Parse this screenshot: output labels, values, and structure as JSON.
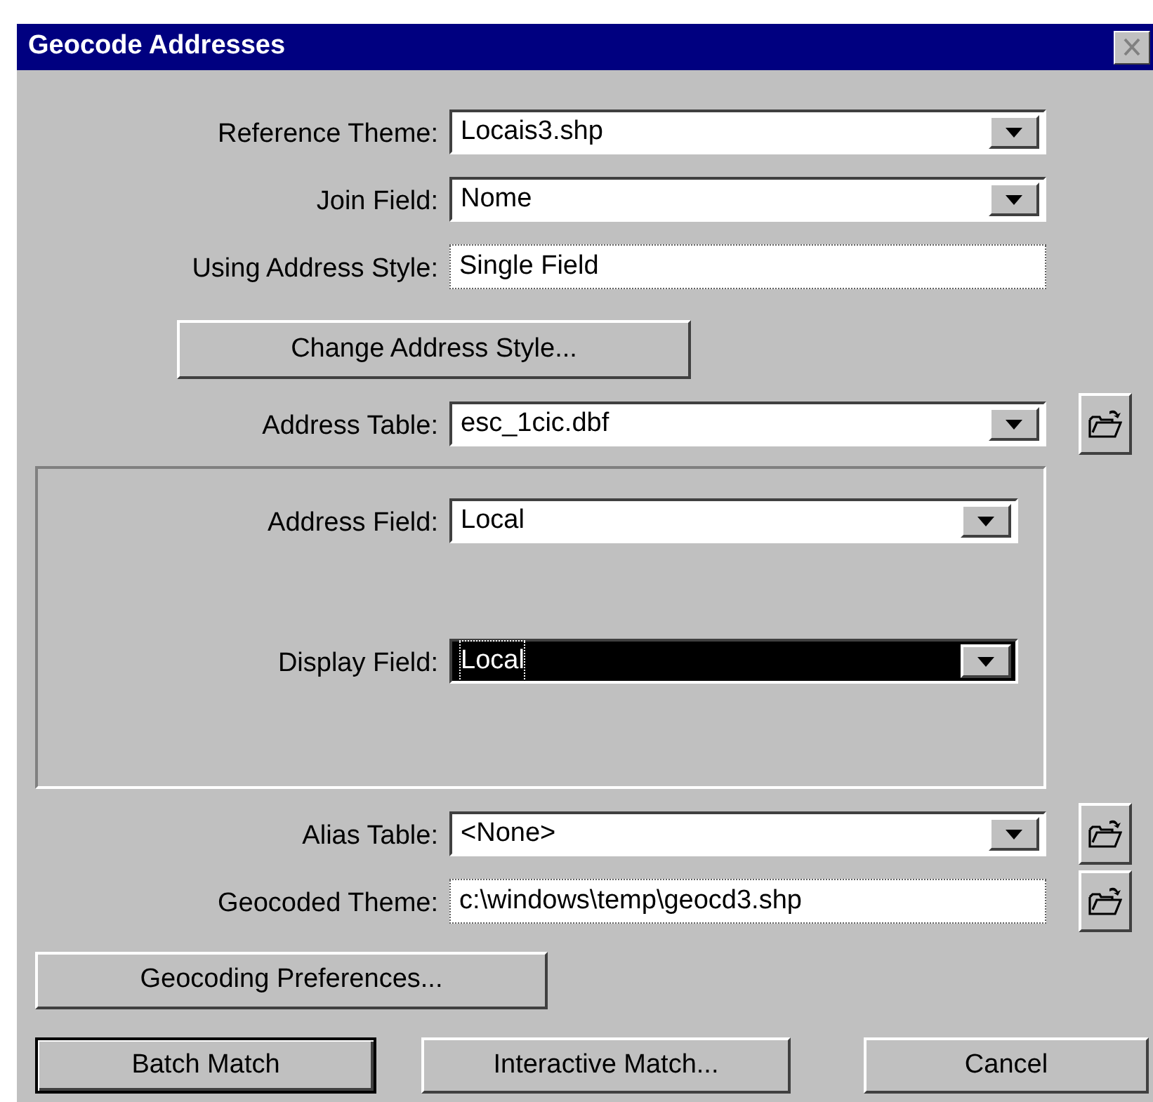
{
  "window": {
    "title": "Geocode Addresses"
  },
  "top_fields": [
    {
      "label": "Reference Theme:",
      "value": "Locais3.shp",
      "kind": "dropdown"
    },
    {
      "label": "Join Field:",
      "value": "Nome",
      "kind": "dropdown"
    },
    {
      "label": "Using Address Style:",
      "value": "Single Field",
      "kind": "text"
    }
  ],
  "change_style_button": "Change Address Style...",
  "address_table": {
    "label": "Address Table:",
    "value": "esc_1cic.dbf",
    "kind": "dropdown"
  },
  "group_fields": [
    {
      "label": "Address Field:",
      "value": "Local",
      "selected": false
    },
    {
      "label": "Display Field:",
      "value": "Local",
      "selected": true
    }
  ],
  "bottom_fields": [
    {
      "label": "Alias Table:",
      "value": "<None>",
      "kind": "dropdown"
    },
    {
      "label": "Geocoded Theme:",
      "value": "c:\\windows\\temp\\geocd3.shp",
      "kind": "text"
    }
  ],
  "preferences_button": "Geocoding Preferences...",
  "buttons": [
    {
      "label": "Batch Match",
      "default": true
    },
    {
      "label": "Interactive Match...",
      "default": false
    },
    {
      "label": "Cancel",
      "default": false
    }
  ]
}
